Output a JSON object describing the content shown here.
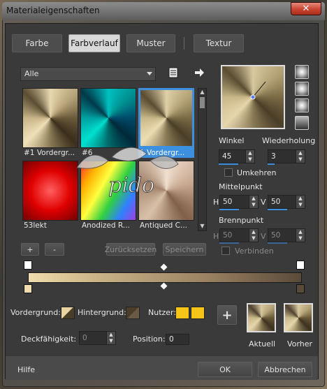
{
  "window": {
    "title": "Materialeigenschaften",
    "close": "✕"
  },
  "tabs": [
    {
      "label": "Farbe",
      "active": false
    },
    {
      "label": "Farbverlauf",
      "active": true
    },
    {
      "label": "Muster",
      "active": false
    },
    {
      "label": "Textur",
      "active": false
    }
  ],
  "gallery": {
    "category": "Alle",
    "arrow_icon": "arrow-right-icon",
    "items": [
      {
        "caption": "#1 Vordergr...",
        "style": "conic-gradient(from 0deg,#e8d8b0,#b8a47a,#6a5a3a,#3a2e1c,#8a7a55,#f0e0b8,#c8b488,#5a4d32,#e8d8b0)",
        "selected": false
      },
      {
        "caption": "#6",
        "style": "conic-gradient(from 0deg,#00c0c0,#009090,#004a6a,#002a3a,#006a6a,#00e0d0,#00a0a0,#003a4a,#00c0c0)",
        "selected": false
      },
      {
        "caption": "1 Vordergr...",
        "style": "conic-gradient(from 0deg,#e0d0a8,#b5a478,#7a6a45,#4a3e28,#8a7a55,#ecdcb2,#c8b888,#5a4d32,#e0d0a8)",
        "selected": true
      },
      {
        "caption": "53lekt",
        "style": "radial-gradient(circle at 50% 50%,#ff6060,#e00000 50%,#700000)",
        "selected": false
      },
      {
        "caption": "Anodized R...",
        "style": "linear-gradient(120deg,#ff3030,#ffb000,#ffff40,#30d040,#3080ff,#a040e0)",
        "selected": false
      },
      {
        "caption": "Antiqued C...",
        "style": "conic-gradient(from 0deg,#f0e0d0,#c8a890,#806048,#d8c0a8,#a08068,#f0e0d0)",
        "selected": false
      }
    ]
  },
  "gradient_buttons": {
    "add": "+",
    "remove": "-",
    "reset": "Zurücksetzen",
    "save": "Speichern"
  },
  "preview": {
    "winkel_label": "Winkel",
    "winkel_value": "45",
    "wiederholung_label": "Wiederholung",
    "wiederholung_value": "3",
    "umkehren_label": "Umkehren",
    "mittelpunkt_label": "Mittelpunkt",
    "mittel_h_label": "H",
    "mittel_h": "50",
    "mittel_v_label": "V",
    "mittel_v": "50",
    "brennpunkt_label": "Brennpunkt",
    "brenn_h_label": "H",
    "brenn_h": "50",
    "brenn_v_label": "V",
    "brenn_v": "50",
    "verbinden_label": "Verbinden"
  },
  "lower": {
    "vordergrund_label": "Vordergrund:",
    "hintergrund_label": "Hintergrund:",
    "nutzer_label": "Nutzer:",
    "nutzer_color": "#f5c518",
    "deckfahigkeit_label": "Deckfähigkeit:",
    "deckfahigkeit_value": "0",
    "position_label": "Position:",
    "position_value": "0",
    "plus": "+",
    "aktuell_label": "Aktuell",
    "vorher_label": "Vorher"
  },
  "footer": {
    "help": "Hilfe",
    "ok": "OK",
    "cancel": "Abbrechen"
  },
  "watermark_text": "pido"
}
